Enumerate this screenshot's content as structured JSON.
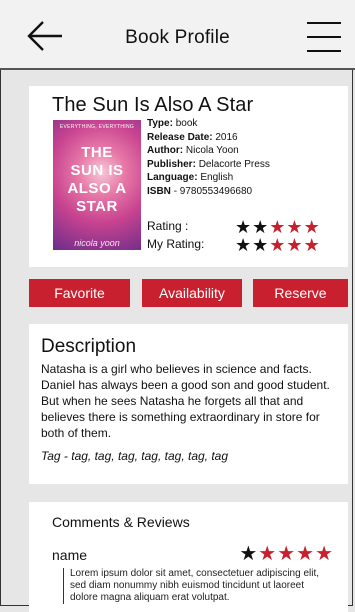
{
  "header": {
    "title": "Book Profile"
  },
  "book": {
    "title": "The Sun Is Also A Star",
    "cover": {
      "top_text": "EVERYTHING, EVERYTHING",
      "lines": [
        "THE",
        "SUN IS",
        "ALSO A",
        "STAR"
      ],
      "author": "nicola yoon"
    },
    "type_label": "Type:",
    "type": "book",
    "release_label": "Release Date:",
    "release": "2016",
    "author_label": "Author:",
    "author": "Nicola Yoon",
    "publisher_label": "Publisher:",
    "publisher": "Delacorte Press",
    "language_label": "Language:",
    "language": "English",
    "isbn_label": "ISBN",
    "isbn": "- 9780553496680",
    "rating_label": "Rating :",
    "rating": 2,
    "rating_max": 5,
    "my_rating_label": "My Rating:",
    "my_rating": 2,
    "my_rating_max": 5
  },
  "actions": {
    "favorite": "Favorite",
    "availability": "Availability",
    "reserve": "Reserve"
  },
  "description": {
    "title": "Description",
    "text": "Natasha is a girl who believes in science and facts. Daniel has always been a good son and good student. But when he sees Natasha he forgets all that and believes there is something extraordinary in store for both of them.",
    "tags": "Tag - tag, tag, tag, tag, tag, tag, tag"
  },
  "comments": {
    "title": "Comments & Reviews",
    "items": [
      {
        "name": "name",
        "rating": 1,
        "rating_max": 5,
        "text": "Lorem ipsum dolor sit amet, consectetuer adipiscing elit, sed diam nonummy nibh euismod tincidunt ut laoreet dolore magna aliquam erat volutpat."
      }
    ]
  },
  "colors": {
    "accent": "#c8202e",
    "background": "#e6e6e6",
    "card": "#ffffff"
  }
}
